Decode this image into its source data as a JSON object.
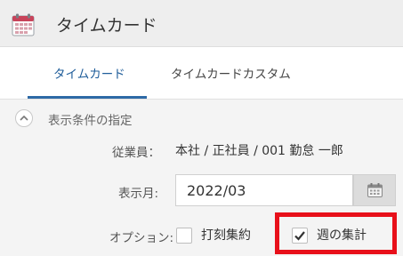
{
  "header": {
    "title": "タイムカード",
    "icon": "calendar-icon",
    "accent": "#c8435a"
  },
  "tabs": [
    {
      "label": "タイムカード",
      "active": true
    },
    {
      "label": "タイムカードカスタム",
      "active": false
    }
  ],
  "conditions": {
    "section_label": "表示条件の指定",
    "employee_label": "従業員：",
    "employee_value": "本社 / 正社員 / 001 勤怠 一郎",
    "month_label": "表示月:",
    "month_value": "2022/03",
    "option_label": "オプション:",
    "options": [
      {
        "label": "打刻集約",
        "checked": false
      },
      {
        "label": "週の集計",
        "checked": true
      }
    ]
  },
  "colors": {
    "tab_active": "#1f5d9a",
    "highlight": "#e8101a"
  }
}
